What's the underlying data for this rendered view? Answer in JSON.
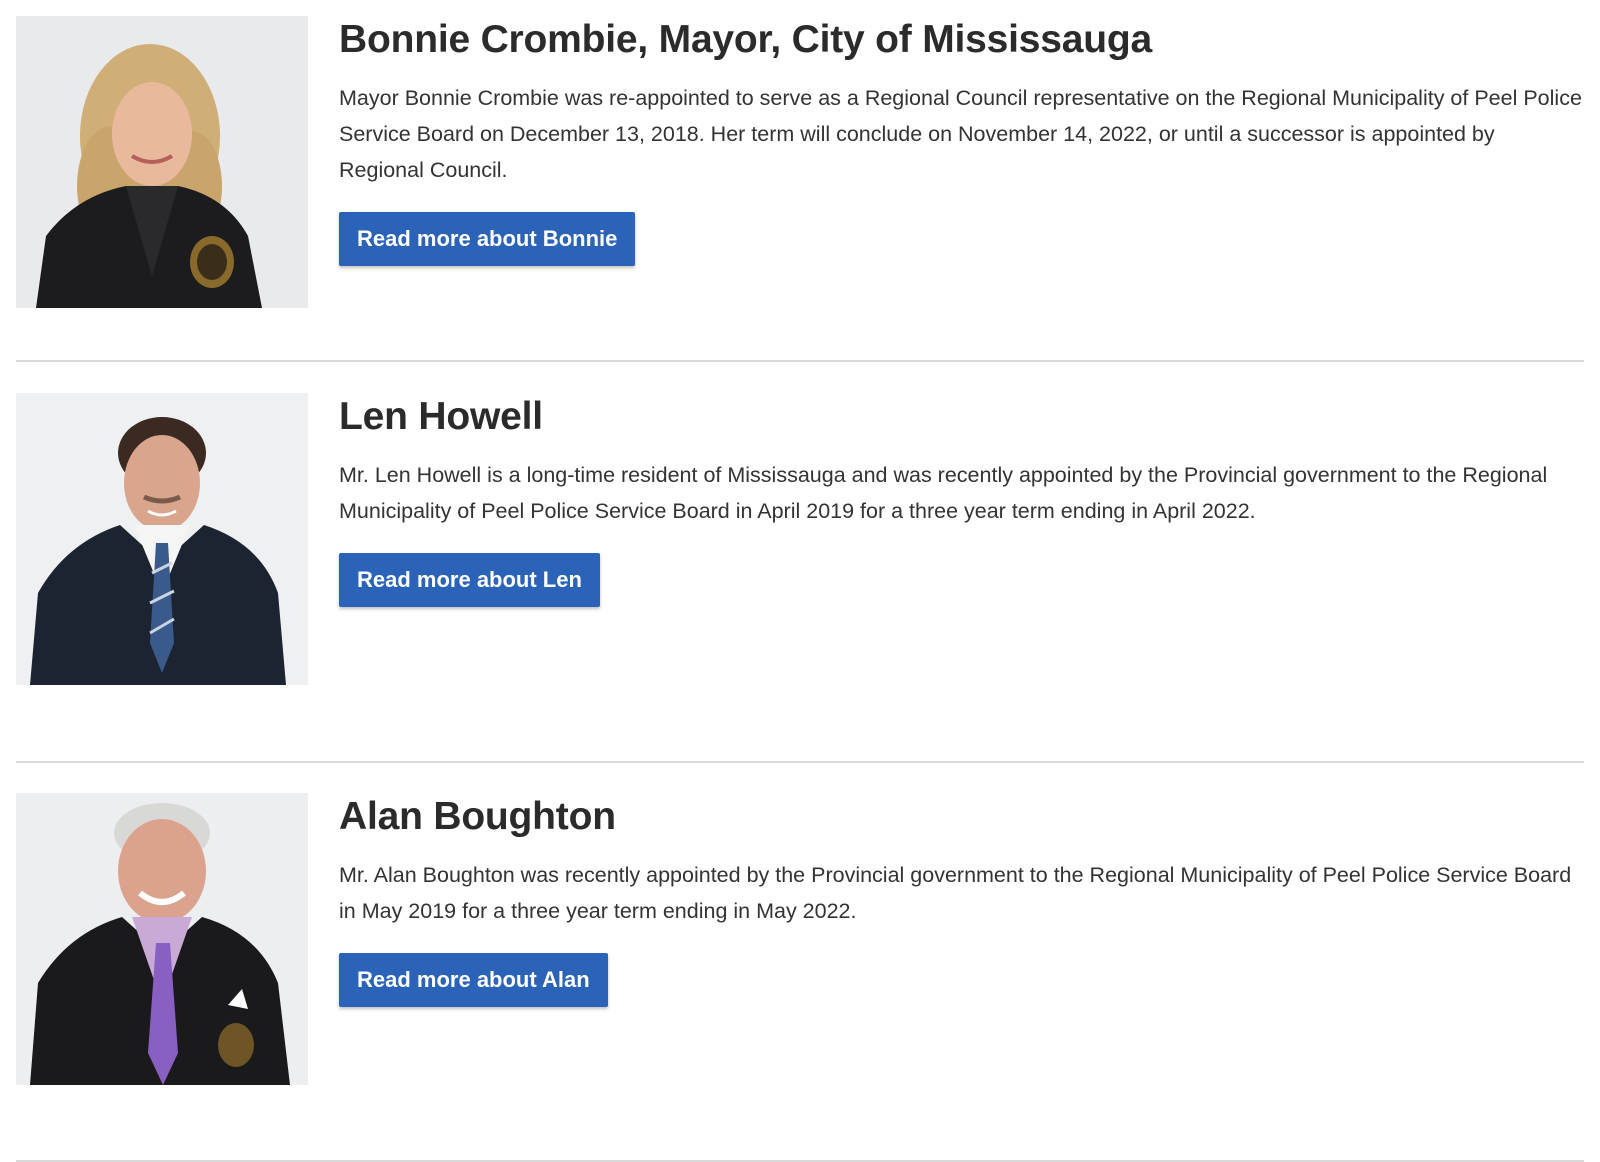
{
  "members": [
    {
      "name": "Bonnie Crombie, Mayor, City of Mississauga",
      "bio": "Mayor Bonnie Crombie was re-appointed to serve as a Regional Council representative on the Regional Municipality of Peel Police Service Board on December 13, 2018. Her term will conclude on November 14, 2022, or until a successor is appointed by Regional Council.",
      "button_label": "Read more about Bonnie",
      "photo_alt": "Bonnie Crombie"
    },
    {
      "name": "Len Howell",
      "bio": "Mr. Len Howell is a long-time resident of Mississauga and was recently appointed by the Provincial government to the Regional Municipality of Peel Police Service Board in April 2019 for a three year term ending in April 2022.",
      "button_label": "Read more about Len",
      "photo_alt": "Len Howell"
    },
    {
      "name": "Alan Boughton",
      "bio": "Mr. Alan Boughton was recently appointed by the Provincial government to the Regional Municipality of Peel Police Service Board in May 2019 for a three year term ending in May 2022.",
      "button_label": "Read more about Alan",
      "photo_alt": "Alan Boughton"
    }
  ],
  "colors": {
    "button_bg": "#2a63b8",
    "button_text": "#ffffff",
    "heading": "#2b2b2b",
    "body_text": "#333333",
    "divider": "#d9d9d9"
  }
}
